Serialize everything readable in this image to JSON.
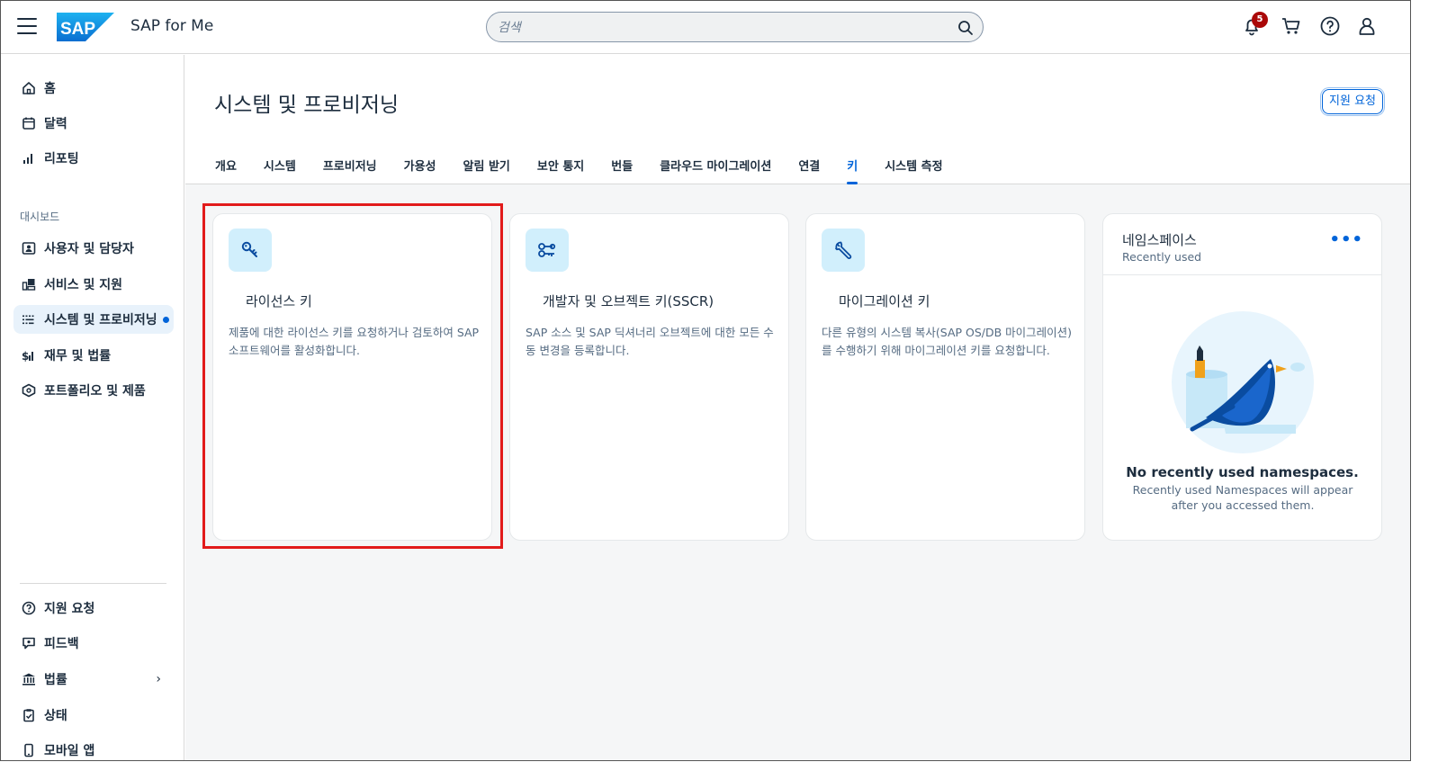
{
  "header": {
    "app_title": "SAP for Me",
    "logo_text": "SAP",
    "search_placeholder": "검색",
    "notification_count": "5"
  },
  "sidebar": {
    "top_items": [
      {
        "label": "홈",
        "icon": "home-icon"
      },
      {
        "label": "달력",
        "icon": "calendar-icon"
      },
      {
        "label": "리포팅",
        "icon": "bar-chart-icon"
      }
    ],
    "section_label": "대시보드",
    "dashboard_items": [
      {
        "label": "사용자 및 담당자",
        "icon": "contacts-icon"
      },
      {
        "label": "서비스 및 지원",
        "icon": "service-icon"
      },
      {
        "label": "시스템 및 프로비저닝",
        "icon": "systems-icon",
        "active": true
      },
      {
        "label": "재무 및 법률",
        "icon": "finance-icon"
      },
      {
        "label": "포트폴리오 및 제품",
        "icon": "product-icon"
      }
    ],
    "bottom_items": [
      {
        "label": "지원 요청",
        "icon": "question-icon"
      },
      {
        "label": "피드백",
        "icon": "feedback-icon"
      },
      {
        "label": "법률",
        "icon": "legal-icon"
      },
      {
        "label": "상태",
        "icon": "status-icon"
      },
      {
        "label": "모바일 앱",
        "icon": "mobile-icon"
      }
    ]
  },
  "page": {
    "title": "시스템 및 프로비저닝",
    "support_button": "지원 요청",
    "tabs": [
      "개요",
      "시스템",
      "프로비저닝",
      "가용성",
      "알림 받기",
      "보안 통지",
      "번들",
      "클라우드 마이그레이션",
      "연결",
      "키",
      "시스템 측정"
    ],
    "active_tab": "키"
  },
  "cards": [
    {
      "title": "라이선스 키",
      "icon": "key-icon",
      "description": "제품에 대한 라이선스 키를 요청하거나 검토하여 SAP 소프트웨어를 활성화합니다."
    },
    {
      "title": "개발자 및 오브젝트 키(SSCR)",
      "icon": "developer-key-icon",
      "description": "SAP 소스 및 SAP 딕셔너리 오브젝트에 대한 모든 수동 변경을 등록합니다."
    },
    {
      "title": "마이그레이션 키",
      "icon": "wrench-icon",
      "description": "다른 유형의 시스템 복사(SAP OS/DB 마이그레이션)를 수행하기 위해 마이그레이션 키를 요청합니다."
    }
  ],
  "namespaces": {
    "title": "네임스페이스",
    "subtitle": "Recently used",
    "empty_title": "No recently used namespaces.",
    "empty_description": "Recently used Namespaces will appear after you accessed them."
  },
  "colors": {
    "accent": "#0064d9",
    "highlight": "#e21b1b",
    "badge": "#aa0808",
    "tile_bg": "#d1effc"
  }
}
